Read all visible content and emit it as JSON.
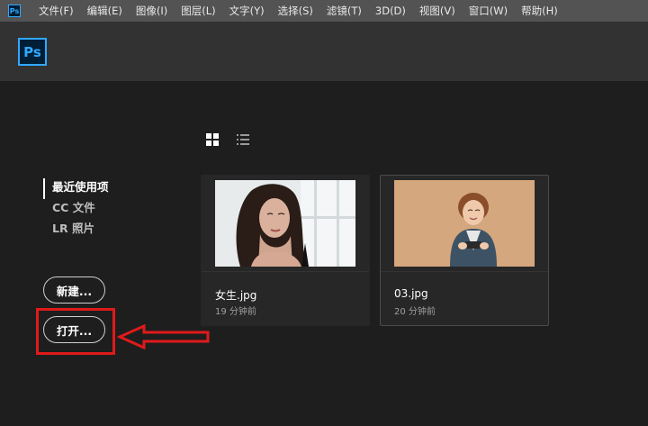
{
  "menubar": {
    "app_icon": "Ps",
    "items": [
      "文件(F)",
      "编辑(E)",
      "图像(I)",
      "图层(L)",
      "文字(Y)",
      "选择(S)",
      "滤镜(T)",
      "3D(D)",
      "视图(V)",
      "窗口(W)",
      "帮助(H)"
    ]
  },
  "header": {
    "logo": "Ps",
    "logo_color": "#31a8ff"
  },
  "view_toggle": {
    "grid_icon": "grid-view-icon",
    "list_icon": "list-view-icon"
  },
  "sidebar": {
    "items": [
      {
        "label": "最近使用项",
        "active": true
      },
      {
        "label": "CC 文件",
        "active": false
      },
      {
        "label": "LR 照片",
        "active": false
      }
    ]
  },
  "buttons": {
    "new_label": "新建...",
    "open_label": "打开..."
  },
  "annotation": {
    "highlight_color": "#e01a1a",
    "arrow_direction": "left"
  },
  "recent_files": [
    {
      "name": "女生.jpg",
      "time": "19 分钟前"
    },
    {
      "name": "03.jpg",
      "time": "20 分钟前"
    }
  ]
}
